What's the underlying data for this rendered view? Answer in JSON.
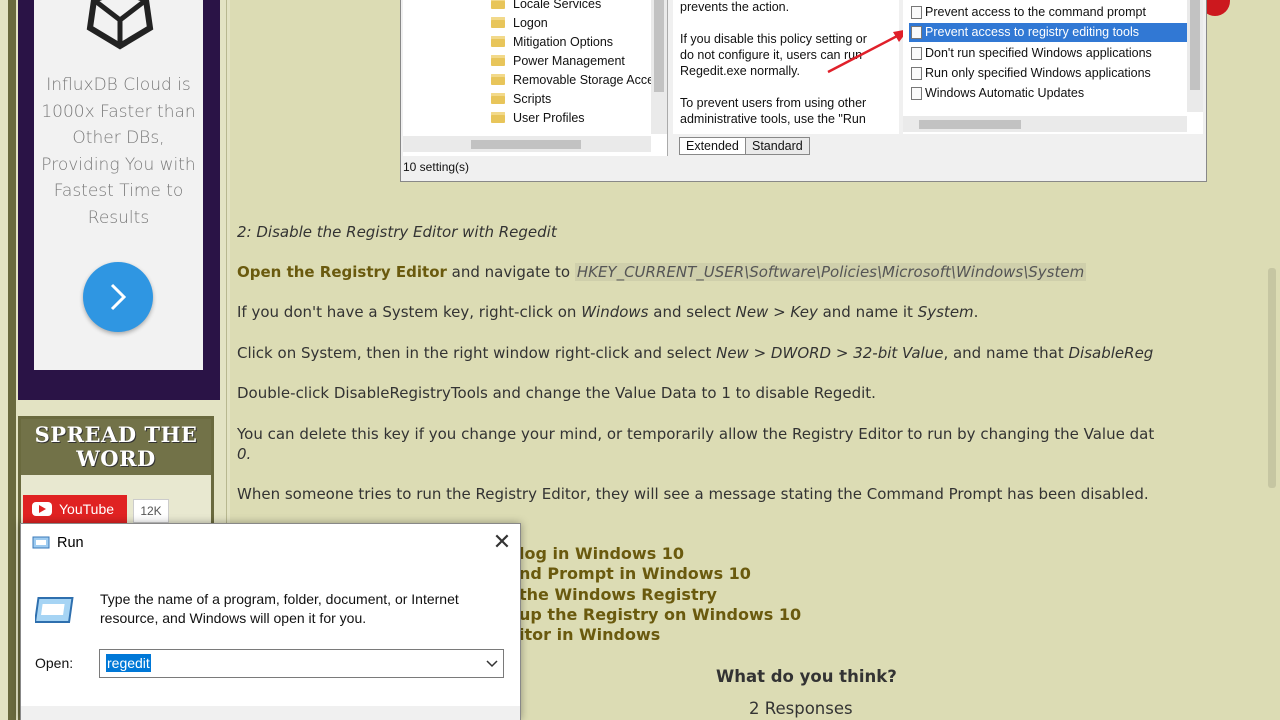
{
  "sidebar": {
    "ad": {
      "text": "InfluxDB Cloud is 1000x Faster than Other DBs, Providing You with Fastest Time to Results"
    },
    "spread": {
      "title": "SPREAD THE WORD",
      "youtube_label": "YouTube",
      "youtube_count": "12K"
    }
  },
  "gpedit": {
    "tree_items": [
      "Locale Services",
      "Logon",
      "Mitigation Options",
      "Power Management",
      "Removable Storage Acce",
      "Scripts",
      "User Profiles"
    ],
    "desc_lines": [
      "prevents the action.",
      "",
      "If you disable this policy setting or",
      "do not configure it, users can run",
      "Regedit.exe normally.",
      "",
      "To prevent users from using other",
      "administrative tools, use the \"Run"
    ],
    "settings": [
      "Prevent access to the command prompt",
      "Prevent access to registry editing tools",
      "Don't run specified Windows applications",
      "Run only specified Windows applications",
      "Windows Automatic Updates"
    ],
    "tabs": [
      "Extended",
      "Standard"
    ],
    "status": "10 setting(s)"
  },
  "article": {
    "heading2": "2: Disable the Registry Editor with Regedit",
    "open_editor": "Open the Registry Editor",
    "navigate_to": " and navigate to ",
    "reg_path": "HKEY_CURRENT_USER\\Software\\Policies\\Microsoft\\Windows\\System",
    "p_system_1": "If you don't have a System key, right-click on ",
    "p_system_windows": "Windows",
    "p_system_2": " and select ",
    "p_system_newkey": "New > Key",
    "p_system_3": " and name it ",
    "p_system_name": "System",
    "p_system_4": ".",
    "p_click_1": "Click on System, then in the right window right-click and select ",
    "p_click_dword": "New > DWORD > 32-bit Value",
    "p_click_2": ", and name that ",
    "p_click_name": "DisableReg",
    "p_double": "Double-click DisableRegistryTools and change the Value Data to 1 to disable Regedit.",
    "p_delete": "You can delete this key if you change your mind, or temporarily allow the Registry Editor to run by changing the Value dat",
    "p_delete_zero": "0.",
    "p_when": "When someone tries to run the Registry Editor, they will see a message stating the Command Prompt has been disabled.",
    "links": [
      "log in Windows 10",
      "nd Prompt in Windows 10",
      " the Windows Registry",
      "up the Registry on Windows 10",
      "itor in Windows"
    ],
    "what_think": "What do you think?",
    "responses": "2 Responses"
  },
  "run_dialog": {
    "title": "Run",
    "close": "✕",
    "description": "Type the name of a program, folder, document, or Internet resource, and Windows will open it for you.",
    "open_label": "Open:",
    "input_value": "regedit"
  }
}
